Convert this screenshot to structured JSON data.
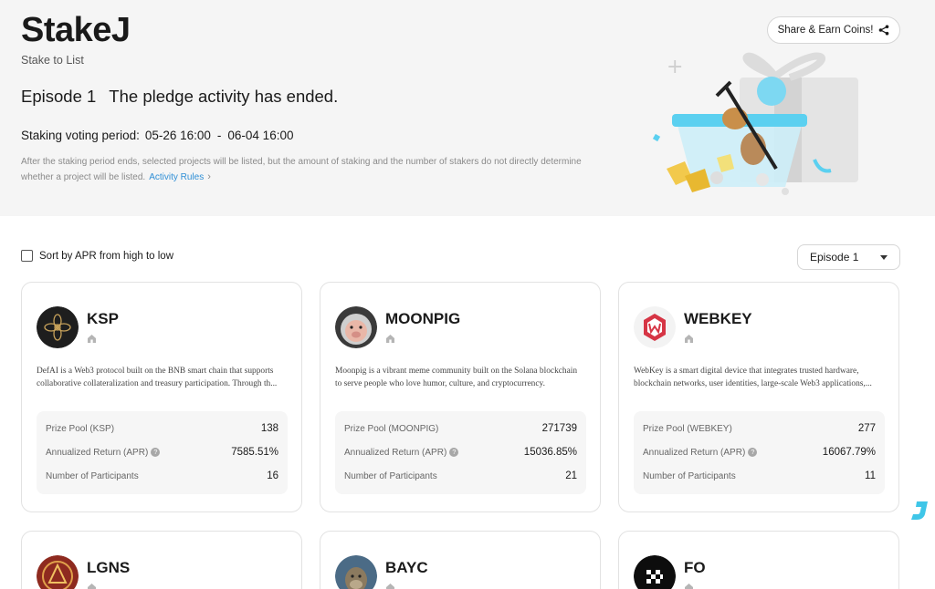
{
  "header": {
    "brand": "StakeJ",
    "subtitle": "Stake to List",
    "episode": "Episode 1",
    "status": "The pledge activity has ended.",
    "period_label": "Staking voting period:",
    "period_start": "05-26 16:00",
    "period_sep": "-",
    "period_end": "06-04 16:00",
    "description_line1": "After the staking period ends, selected projects will be listed, but the amount of staking and the number of stakers do not directly determine",
    "description_line2": "whether a project will be listed.",
    "rules_link": "Activity Rules",
    "share_button": "Share & Earn Coins!"
  },
  "filters": {
    "sort_label": "Sort by APR from high to low",
    "sort_checked": false,
    "episode_selected": "Episode 1"
  },
  "cards": [
    {
      "name": "KSP",
      "desc_line1": "DefAI is a Web3 protocol built on the BNB smart chain that supports",
      "desc_line2": "collaborative collateralization and treasury participation. Through th...",
      "prize_label": "Prize Pool (KSP)",
      "prize_value": "138",
      "apr_label": "Annualized Return (APR)",
      "apr_value": "7585.51%",
      "participants_label": "Number of Participants",
      "participants_value": "16"
    },
    {
      "name": "MOONPIG",
      "desc_line1": "Moonpig is a vibrant meme community built on the Solana blockchain",
      "desc_line2": "to serve people who love humor, culture, and cryptocurrency.",
      "prize_label": "Prize Pool (MOONPIG)",
      "prize_value": "271739",
      "apr_label": "Annualized Return (APR)",
      "apr_value": "15036.85%",
      "participants_label": "Number of Participants",
      "participants_value": "21"
    },
    {
      "name": "WEBKEY",
      "desc_line1": "WebKey is a smart digital device that integrates trusted hardware,",
      "desc_line2": "blockchain networks, user identities, large-scale Web3 applications,...",
      "prize_label": "Prize Pool (WEBKEY)",
      "prize_value": "277",
      "apr_label": "Annualized Return (APR)",
      "apr_value": "16067.79%",
      "participants_label": "Number of Participants",
      "participants_value": "11"
    },
    {
      "name": "LGNS"
    },
    {
      "name": "BAYC"
    },
    {
      "name": "FO"
    }
  ],
  "icons": {
    "share": "share-icon",
    "home": "home-icon",
    "help": "question-icon",
    "caret": "chevron-down-icon",
    "floating": "j-logo-icon"
  },
  "colors": {
    "link": "#2f8fd6",
    "hero_bg": "#f5f5f5",
    "accent_cyan": "#3fc6e8"
  }
}
